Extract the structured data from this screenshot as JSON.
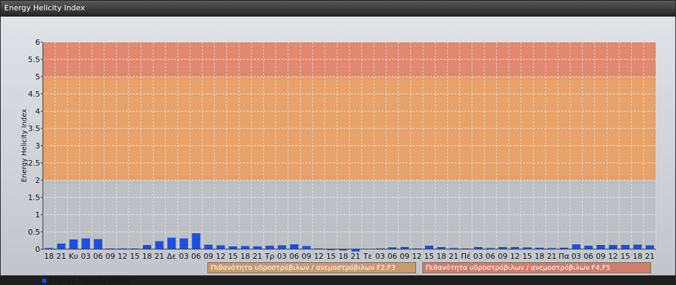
{
  "window": {
    "title": "Energy Helicity Index"
  },
  "chart_data": {
    "type": "bar",
    "ylabel": "Energy Helicity Index",
    "xlabel": "",
    "ylim": [
      0,
      6
    ],
    "yticks": [
      0,
      0.5,
      1,
      1.5,
      2,
      2.5,
      3,
      3.5,
      4,
      4.5,
      5,
      5.5,
      6
    ],
    "grid": true,
    "legend_placement": "bottom-left",
    "categories": [
      "18",
      "21",
      "Κυ",
      "03",
      "06",
      "09",
      "12",
      "15",
      "18",
      "21",
      "Δε",
      "03",
      "06",
      "09",
      "12",
      "15",
      "18",
      "21",
      "Τρ",
      "03",
      "06",
      "09",
      "12",
      "15",
      "18",
      "21",
      "Τε",
      "03",
      "06",
      "09",
      "12",
      "15",
      "18",
      "21",
      "Πέ",
      "03",
      "06",
      "09",
      "12",
      "15",
      "18",
      "21",
      "Πα",
      "03",
      "06",
      "09",
      "12",
      "15",
      "18",
      "21"
    ],
    "series": [
      {
        "name": "Energy Helicity Index",
        "color": "#1a4fe0",
        "values": [
          0.03,
          0.16,
          0.28,
          0.31,
          0.29,
          0.02,
          0.02,
          0.02,
          0.12,
          0.23,
          0.33,
          0.31,
          0.46,
          0.13,
          0.11,
          0.08,
          0.09,
          0.08,
          0.1,
          0.11,
          0.14,
          0.09,
          0.02,
          -0.03,
          -0.04,
          -0.07,
          0.01,
          0.02,
          0.05,
          0.06,
          0.02,
          0.1,
          0.06,
          0.03,
          0.02,
          0.06,
          0.03,
          0.06,
          0.06,
          0.05,
          0.04,
          0.03,
          0.04,
          0.14,
          0.1,
          0.12,
          0.12,
          0.12,
          0.13,
          0.11
        ]
      }
    ],
    "zones": [
      {
        "from": 2,
        "to": 5,
        "color": "#e6a268",
        "label": "Πιθανότητα υδροστρόβιλων / ανεμοστρόβιλων F2,F3"
      },
      {
        "from": 5,
        "to": 6,
        "color": "#e08870",
        "label": "Πιθανότητα υδροστρόβιλων / ανεμοστρόβιλων F4,F5"
      }
    ]
  }
}
